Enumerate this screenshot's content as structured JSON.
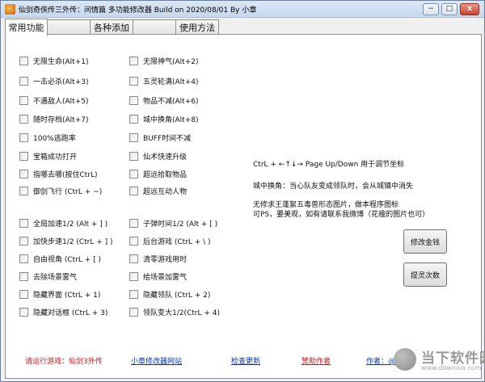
{
  "window": {
    "title": "仙剑奇侠传三外传：问情篇 多功能修改器 Build on 2020/08/01 By 小章",
    "min_label": "−",
    "max_label": "□",
    "close_label": "x"
  },
  "tabs": [
    {
      "label": "常用功能",
      "active": true
    },
    {
      "label": "",
      "active": false
    },
    {
      "label": "各种添加",
      "active": false
    },
    {
      "label": "",
      "active": false
    },
    {
      "label": "使用方法",
      "active": false
    }
  ],
  "checkboxes_left": [
    "无限生命(Alt+1)",
    "一击必杀(Alt+3)",
    "不遇敌人(Alt+5)",
    "随时存档(Alt+7)",
    "100%逃跑率",
    "宝箱成功打开",
    "指哪去哪(按住CtrL)",
    "御剑飞行 (CtrL + ~)",
    "全局加速1/2 (Alt + ] )",
    "加快步速1/2 (CtrL + ] )",
    "自由视角 (CtrL + [ )",
    "去除场景雾气",
    "隐藏界面 (CtrL + 1)",
    "隐藏对话框 (CtrL + 3)"
  ],
  "checkboxes_right": [
    "无限神气(Alt+2)",
    "五灵轮满(Alt+4)",
    "物品不减(Alt+6)",
    "城中换角(Alt+8)",
    "BUFF时间不减",
    "仙术快速升级",
    "超远拾取物品",
    "超远互动人物",
    "子弹时间1/2 (Alt + [ )",
    "后台游戏 (CtrL + \\ )",
    "清零游戏用时",
    "给场景加雾气",
    "隐藏领队 (CtrL + 2)",
    "领队变大1/2(CtrL + 4)"
  ],
  "info": {
    "line1": "CtrL + ←↑↓→ Page Up/Down 用于调节坐标",
    "line2": "城中换角：当心队友变成领队时，会从城镇中消失",
    "line3": "无修求王蓬絮五毒兽形态图片，做本程序图标",
    "line4": "可PS，要美观，如有请联系我微博（花楹的图片也可）"
  },
  "buttons": {
    "modify_money": "修改金钱",
    "extract_count": "提灵次数"
  },
  "footer": {
    "run_game": "请运行游戏：仙剑3外传",
    "website": "小章修改器网站",
    "check_update": "检查更新",
    "donate": "赞助作者",
    "author": "作者：@小章"
  },
  "watermark": {
    "text": "当下软件园",
    "sub": "www.downxia.com"
  },
  "colors": {
    "link_blue": "#0033cc",
    "warning_red": "#d0161b",
    "title_gradient_top": "#dbe7f5"
  }
}
